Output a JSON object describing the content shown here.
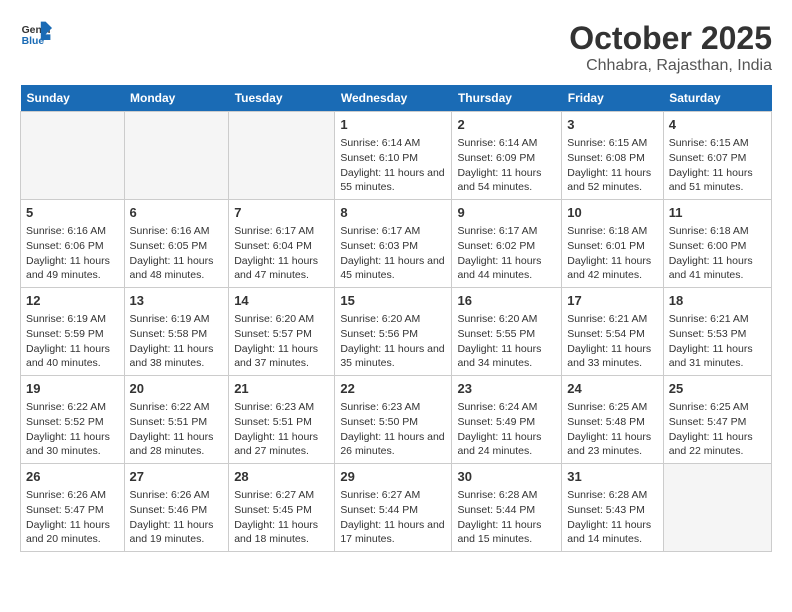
{
  "header": {
    "logo_general": "General",
    "logo_blue": "Blue",
    "main_title": "October 2025",
    "subtitle": "Chhabra, Rajasthan, India"
  },
  "days_of_week": [
    "Sunday",
    "Monday",
    "Tuesday",
    "Wednesday",
    "Thursday",
    "Friday",
    "Saturday"
  ],
  "weeks": [
    [
      {
        "day": "",
        "empty": true
      },
      {
        "day": "",
        "empty": true
      },
      {
        "day": "",
        "empty": true
      },
      {
        "day": "1",
        "sunrise": "Sunrise: 6:14 AM",
        "sunset": "Sunset: 6:10 PM",
        "daylight": "Daylight: 11 hours and 55 minutes."
      },
      {
        "day": "2",
        "sunrise": "Sunrise: 6:14 AM",
        "sunset": "Sunset: 6:09 PM",
        "daylight": "Daylight: 11 hours and 54 minutes."
      },
      {
        "day": "3",
        "sunrise": "Sunrise: 6:15 AM",
        "sunset": "Sunset: 6:08 PM",
        "daylight": "Daylight: 11 hours and 52 minutes."
      },
      {
        "day": "4",
        "sunrise": "Sunrise: 6:15 AM",
        "sunset": "Sunset: 6:07 PM",
        "daylight": "Daylight: 11 hours and 51 minutes."
      }
    ],
    [
      {
        "day": "5",
        "sunrise": "Sunrise: 6:16 AM",
        "sunset": "Sunset: 6:06 PM",
        "daylight": "Daylight: 11 hours and 49 minutes."
      },
      {
        "day": "6",
        "sunrise": "Sunrise: 6:16 AM",
        "sunset": "Sunset: 6:05 PM",
        "daylight": "Daylight: 11 hours and 48 minutes."
      },
      {
        "day": "7",
        "sunrise": "Sunrise: 6:17 AM",
        "sunset": "Sunset: 6:04 PM",
        "daylight": "Daylight: 11 hours and 47 minutes."
      },
      {
        "day": "8",
        "sunrise": "Sunrise: 6:17 AM",
        "sunset": "Sunset: 6:03 PM",
        "daylight": "Daylight: 11 hours and 45 minutes."
      },
      {
        "day": "9",
        "sunrise": "Sunrise: 6:17 AM",
        "sunset": "Sunset: 6:02 PM",
        "daylight": "Daylight: 11 hours and 44 minutes."
      },
      {
        "day": "10",
        "sunrise": "Sunrise: 6:18 AM",
        "sunset": "Sunset: 6:01 PM",
        "daylight": "Daylight: 11 hours and 42 minutes."
      },
      {
        "day": "11",
        "sunrise": "Sunrise: 6:18 AM",
        "sunset": "Sunset: 6:00 PM",
        "daylight": "Daylight: 11 hours and 41 minutes."
      }
    ],
    [
      {
        "day": "12",
        "sunrise": "Sunrise: 6:19 AM",
        "sunset": "Sunset: 5:59 PM",
        "daylight": "Daylight: 11 hours and 40 minutes."
      },
      {
        "day": "13",
        "sunrise": "Sunrise: 6:19 AM",
        "sunset": "Sunset: 5:58 PM",
        "daylight": "Daylight: 11 hours and 38 minutes."
      },
      {
        "day": "14",
        "sunrise": "Sunrise: 6:20 AM",
        "sunset": "Sunset: 5:57 PM",
        "daylight": "Daylight: 11 hours and 37 minutes."
      },
      {
        "day": "15",
        "sunrise": "Sunrise: 6:20 AM",
        "sunset": "Sunset: 5:56 PM",
        "daylight": "Daylight: 11 hours and 35 minutes."
      },
      {
        "day": "16",
        "sunrise": "Sunrise: 6:20 AM",
        "sunset": "Sunset: 5:55 PM",
        "daylight": "Daylight: 11 hours and 34 minutes."
      },
      {
        "day": "17",
        "sunrise": "Sunrise: 6:21 AM",
        "sunset": "Sunset: 5:54 PM",
        "daylight": "Daylight: 11 hours and 33 minutes."
      },
      {
        "day": "18",
        "sunrise": "Sunrise: 6:21 AM",
        "sunset": "Sunset: 5:53 PM",
        "daylight": "Daylight: 11 hours and 31 minutes."
      }
    ],
    [
      {
        "day": "19",
        "sunrise": "Sunrise: 6:22 AM",
        "sunset": "Sunset: 5:52 PM",
        "daylight": "Daylight: 11 hours and 30 minutes."
      },
      {
        "day": "20",
        "sunrise": "Sunrise: 6:22 AM",
        "sunset": "Sunset: 5:51 PM",
        "daylight": "Daylight: 11 hours and 28 minutes."
      },
      {
        "day": "21",
        "sunrise": "Sunrise: 6:23 AM",
        "sunset": "Sunset: 5:51 PM",
        "daylight": "Daylight: 11 hours and 27 minutes."
      },
      {
        "day": "22",
        "sunrise": "Sunrise: 6:23 AM",
        "sunset": "Sunset: 5:50 PM",
        "daylight": "Daylight: 11 hours and 26 minutes."
      },
      {
        "day": "23",
        "sunrise": "Sunrise: 6:24 AM",
        "sunset": "Sunset: 5:49 PM",
        "daylight": "Daylight: 11 hours and 24 minutes."
      },
      {
        "day": "24",
        "sunrise": "Sunrise: 6:25 AM",
        "sunset": "Sunset: 5:48 PM",
        "daylight": "Daylight: 11 hours and 23 minutes."
      },
      {
        "day": "25",
        "sunrise": "Sunrise: 6:25 AM",
        "sunset": "Sunset: 5:47 PM",
        "daylight": "Daylight: 11 hours and 22 minutes."
      }
    ],
    [
      {
        "day": "26",
        "sunrise": "Sunrise: 6:26 AM",
        "sunset": "Sunset: 5:47 PM",
        "daylight": "Daylight: 11 hours and 20 minutes."
      },
      {
        "day": "27",
        "sunrise": "Sunrise: 6:26 AM",
        "sunset": "Sunset: 5:46 PM",
        "daylight": "Daylight: 11 hours and 19 minutes."
      },
      {
        "day": "28",
        "sunrise": "Sunrise: 6:27 AM",
        "sunset": "Sunset: 5:45 PM",
        "daylight": "Daylight: 11 hours and 18 minutes."
      },
      {
        "day": "29",
        "sunrise": "Sunrise: 6:27 AM",
        "sunset": "Sunset: 5:44 PM",
        "daylight": "Daylight: 11 hours and 17 minutes."
      },
      {
        "day": "30",
        "sunrise": "Sunrise: 6:28 AM",
        "sunset": "Sunset: 5:44 PM",
        "daylight": "Daylight: 11 hours and 15 minutes."
      },
      {
        "day": "31",
        "sunrise": "Sunrise: 6:28 AM",
        "sunset": "Sunset: 5:43 PM",
        "daylight": "Daylight: 11 hours and 14 minutes."
      },
      {
        "day": "",
        "empty": true
      }
    ]
  ]
}
